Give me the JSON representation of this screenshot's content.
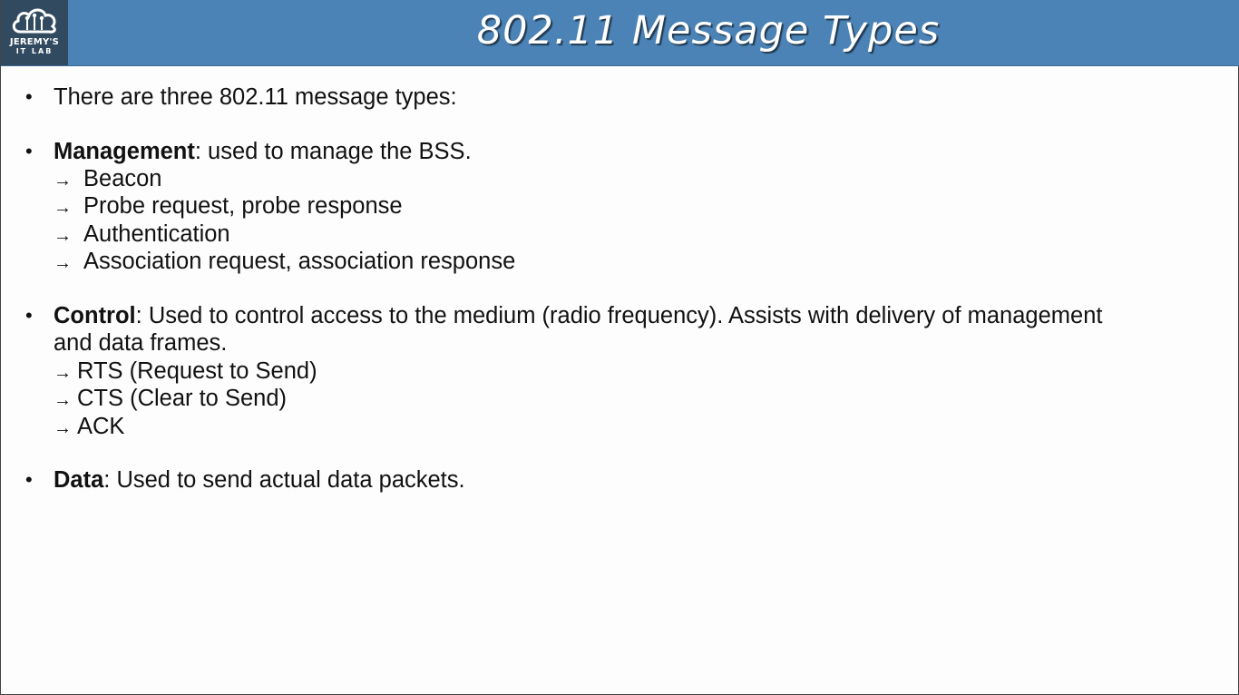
{
  "header": {
    "title": "802.11 Message Types",
    "logo_line1": "JEREMY'S",
    "logo_line2": "IT LAB",
    "bg_color": "#4b83b6"
  },
  "arrow": "→",
  "bullets": {
    "intro": "There are three 802.11 message types:",
    "management": {
      "term": "Management",
      "desc": ": used to manage the BSS.",
      "items": [
        "Beacon",
        "Probe request, probe response",
        "Authentication",
        "Association request, association response"
      ]
    },
    "control": {
      "term": "Control",
      "desc": ": Used to control access to the medium (radio frequency).  Assists with delivery of management",
      "desc_cont": "and data frames.",
      "items": [
        "RTS (Request to Send)",
        "CTS (Clear to Send)",
        "ACK"
      ]
    },
    "data": {
      "term": "Data",
      "desc": ": Used to send actual data packets."
    }
  }
}
